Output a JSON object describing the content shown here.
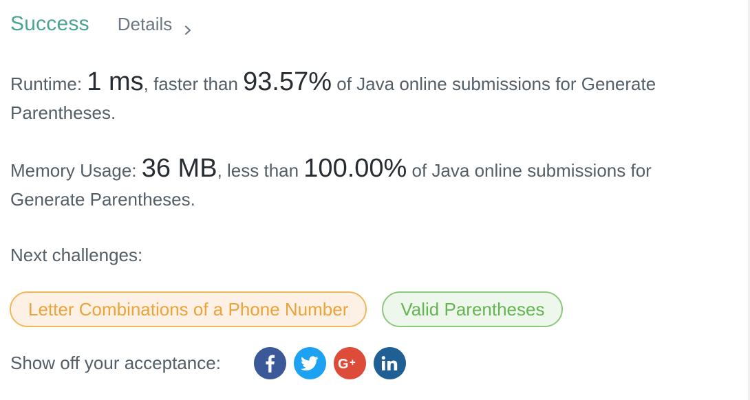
{
  "header": {
    "status": "Success",
    "details_label": "Details"
  },
  "runtime": {
    "prefix": "Runtime: ",
    "value": "1 ms",
    "middle": ", faster than ",
    "percent": "93.57%",
    "suffix": " of Java online submissions for Generate Parentheses."
  },
  "memory": {
    "prefix": "Memory Usage: ",
    "value": "36 MB",
    "middle": ", less than ",
    "percent": "100.00%",
    "suffix": " of Java online submissions for Generate Parentheses."
  },
  "next": {
    "label": "Next challenges:",
    "challenges": [
      {
        "title": "Letter Combinations of a Phone Number",
        "color": "#f3b65a"
      },
      {
        "title": "Valid Parentheses",
        "color": "#8cc77e"
      }
    ]
  },
  "share": {
    "label": "Show off your acceptance:",
    "networks": [
      {
        "icon": "facebook-icon",
        "color": "#3b5998"
      },
      {
        "icon": "twitter-icon",
        "color": "#1da1f2"
      },
      {
        "icon": "google-plus-icon",
        "color": "#dd4b39"
      },
      {
        "icon": "linkedin-icon",
        "color": "#1f5f93"
      }
    ]
  },
  "colors": {
    "success": "#4ba394",
    "text": "#545e66",
    "emphasis": "#262c31"
  }
}
